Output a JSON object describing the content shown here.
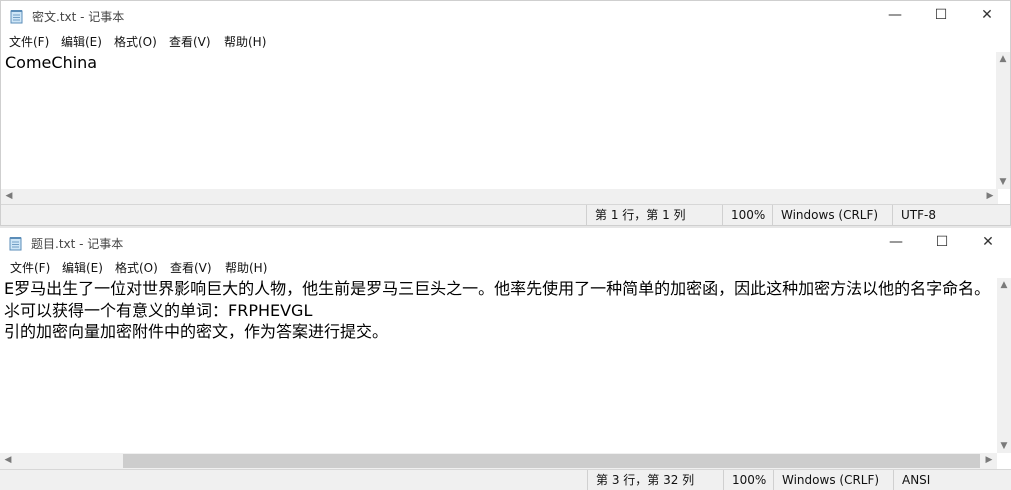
{
  "window1": {
    "title": "密文.txt - 记事本",
    "menu": [
      "文件(F)",
      "编辑(E)",
      "格式(O)",
      "查看(V)",
      "帮助(H)"
    ],
    "content": [
      "ComeChina"
    ],
    "status": {
      "position": "第 1 行，第 1 列",
      "zoom": "100%",
      "line_ending": "Windows (CRLF)",
      "encoding": "UTF-8"
    }
  },
  "window2": {
    "title": "题目.txt - 记事本",
    "menu": [
      "文件(F)",
      "编辑(E)",
      "格式(O)",
      "查看(V)",
      "帮助(H)"
    ],
    "content": [
      "E罗马出生了一位对世界影响巨大的人物，他生前是罗马三巨头之一。他率先使用了一种简单的加密函，因此这种加密方法以他的名字命名。",
      "⺢可以获得一个有意义的单词：FRPHEVGL",
      "引的加密向量加密附件中的密文，作为答案进行提交。"
    ],
    "status": {
      "position": "第 3 行，第 32 列",
      "zoom": "100%",
      "line_ending": "Windows (CRLF)",
      "encoding": "ANSI"
    }
  },
  "caption_buttons": {
    "minimize": "—",
    "maximize": "☐",
    "close": "✕"
  },
  "icons": {
    "app": "notepad-icon"
  }
}
